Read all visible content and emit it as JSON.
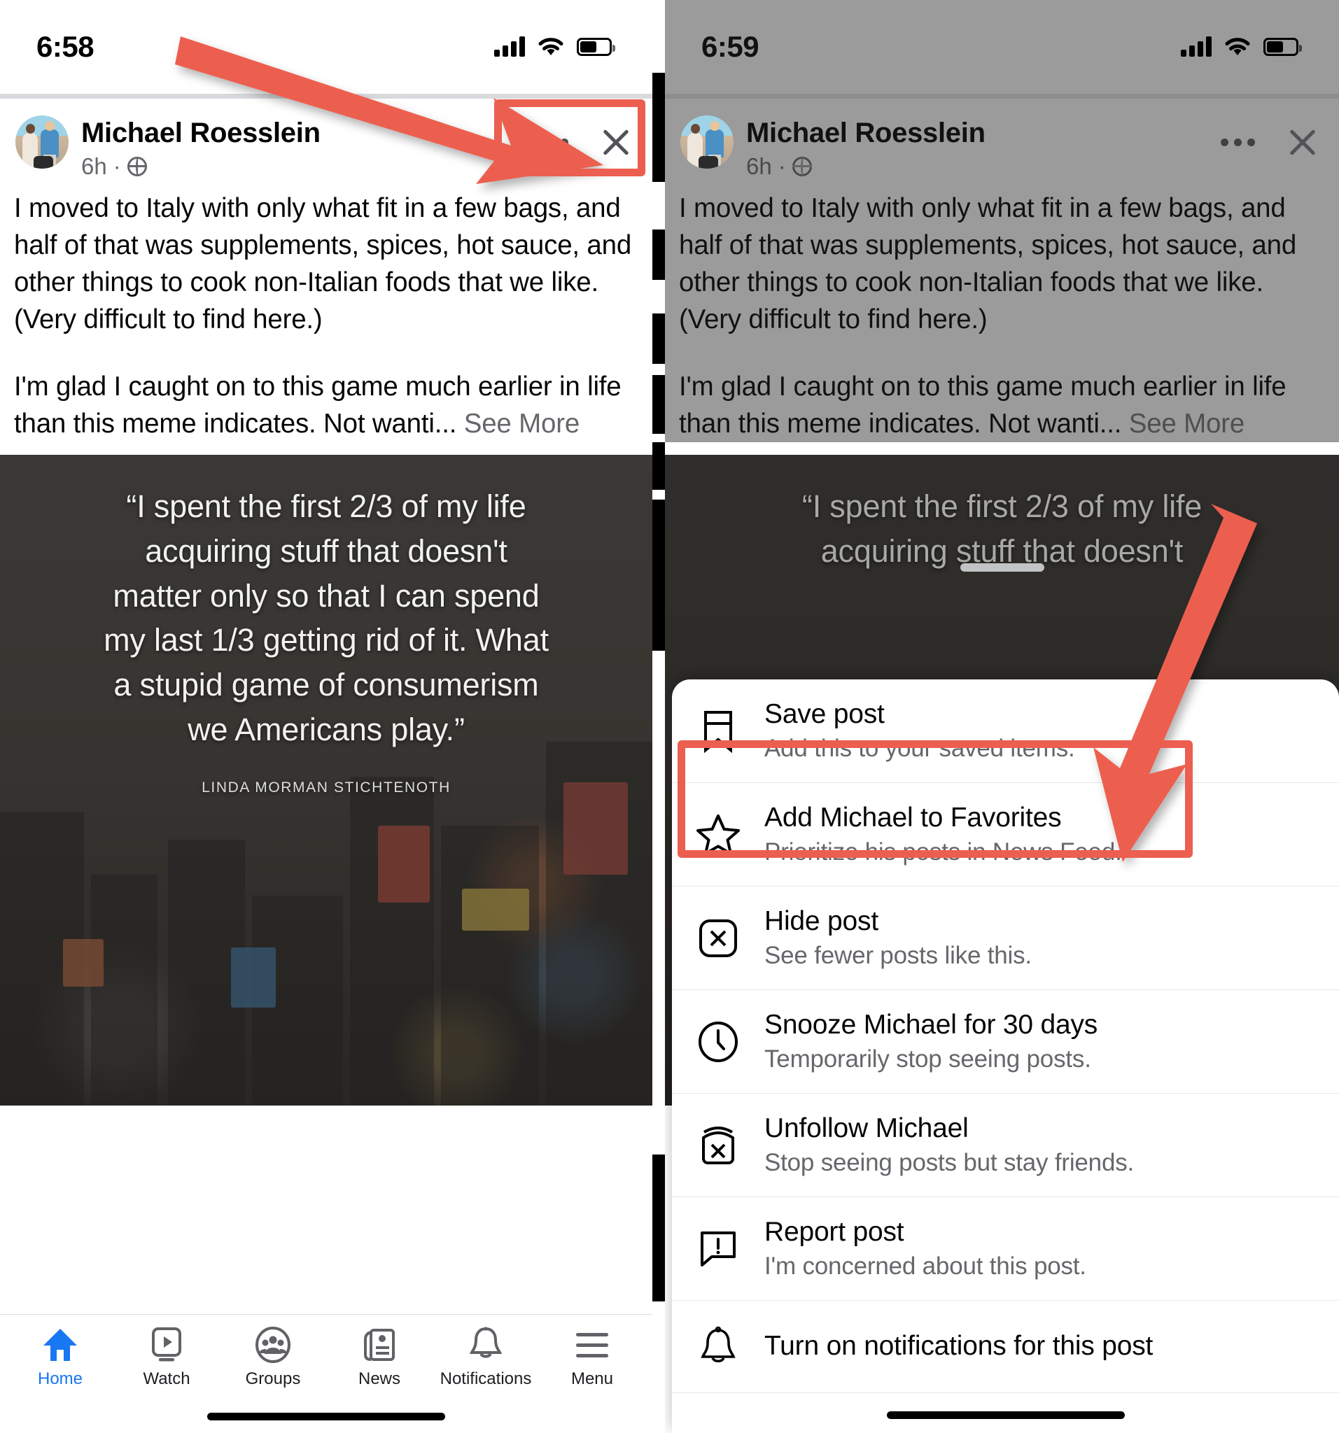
{
  "left_screen": {
    "status": {
      "time": "6:58",
      "signal": "signal-bars",
      "wifi": "wifi",
      "battery": "battery"
    },
    "post": {
      "author": "Michael Roesslein",
      "time_ago": "6h",
      "dot": "·",
      "audience_icon": "globe-icon",
      "paragraph1": "I moved to Italy with only what fit in a few bags, and half of that was supplements, spices, hot sauce, and other things to cook non-Italian foods that we like. (Very difficult to find here.)",
      "paragraph2": "I'm glad I caught on to this game much earlier in life than this meme indicates. Not wanti...",
      "see_more": "See More"
    },
    "meme": {
      "lines": [
        "“I spent the first 2/3 of my life",
        "acquiring stuff that doesn't",
        "matter only so that I can spend",
        "my last 1/3 getting rid of it. What",
        "a stupid game of consumerism",
        "we Americans play.”"
      ],
      "attribution": "LINDA MORMAN STICHTENOTH"
    },
    "nav": {
      "items": [
        {
          "label": "Home",
          "icon": "home-icon",
          "active": true
        },
        {
          "label": "Watch",
          "icon": "watch-icon",
          "active": false
        },
        {
          "label": "Groups",
          "icon": "groups-icon",
          "active": false
        },
        {
          "label": "News",
          "icon": "news-icon",
          "active": false
        },
        {
          "label": "Notifications",
          "icon": "bell-icon",
          "active": false
        },
        {
          "label": "Menu",
          "icon": "hamburger-icon",
          "active": false
        }
      ]
    }
  },
  "right_screen": {
    "status": {
      "time": "6:59",
      "signal": "signal-bars",
      "wifi": "wifi",
      "battery": "battery"
    },
    "post": {
      "author": "Michael Roesslein",
      "time_ago": "6h",
      "dot": "·",
      "audience_icon": "globe-icon",
      "paragraph1": "I moved to Italy with only what fit in a few bags, and half of that was supplements, spices, hot sauce, and other things to cook non-Italian foods that we like. (Very difficult to find here.)",
      "paragraph2": "I'm glad I caught on to this game much earlier in life than this meme indicates. Not wanti...",
      "see_more": "See More"
    },
    "meme": {
      "lines": [
        "“I spent the first 2/3 of my life",
        "acquiring stuff that doesn't"
      ]
    },
    "action_sheet": {
      "items": [
        {
          "icon": "bookmark-icon",
          "title": "Save post",
          "subtitle": "Add this to your saved items."
        },
        {
          "icon": "star-icon",
          "title": "Add Michael to Favorites",
          "subtitle": "Prioritize his posts in News Feed."
        },
        {
          "icon": "hide-x-icon",
          "title": "Hide post",
          "subtitle": "See fewer posts like this."
        },
        {
          "icon": "clock-icon",
          "title": "Snooze Michael for 30 days",
          "subtitle": "Temporarily stop seeing posts."
        },
        {
          "icon": "unfollow-icon",
          "title": "Unfollow Michael",
          "subtitle": "Stop seeing posts but stay friends."
        },
        {
          "icon": "report-icon",
          "title": "Report post",
          "subtitle": "I'm concerned about this post."
        },
        {
          "icon": "bell-outline-icon",
          "title": "Turn on notifications for this post",
          "subtitle": ""
        }
      ]
    }
  },
  "annotations": {
    "accent_color": "#ec5e4f",
    "arrow_left": "arrow-pointing-to-post-menu-controls",
    "highlight_left": "post-header-controls-highlight",
    "arrow_right": "arrow-pointing-to-add-to-favorites",
    "highlight_right": "add-michael-to-favorites-highlight"
  }
}
